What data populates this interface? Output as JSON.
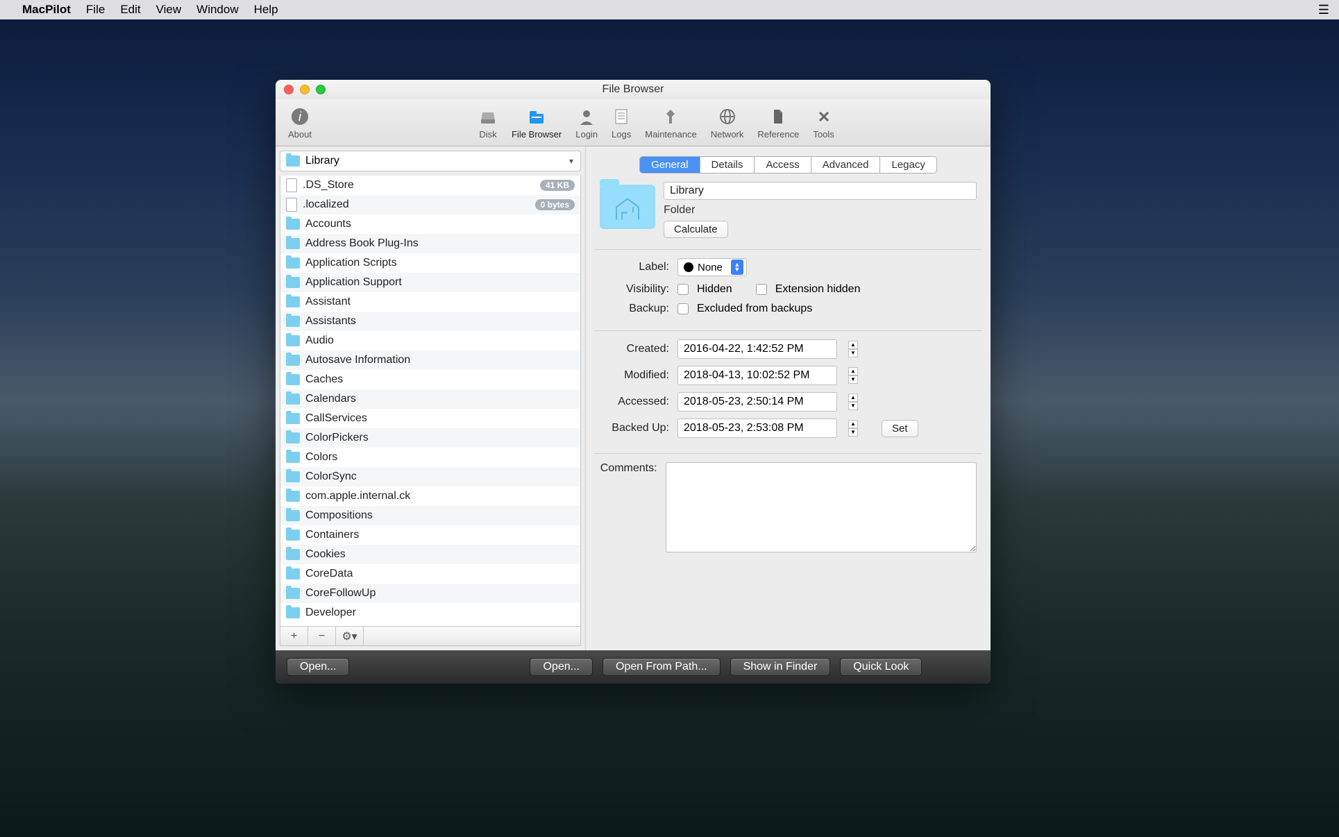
{
  "menubar": {
    "app": "MacPilot",
    "items": [
      "File",
      "Edit",
      "View",
      "Window",
      "Help"
    ]
  },
  "window": {
    "title": "File Browser"
  },
  "toolbar": {
    "items": [
      {
        "label": "About",
        "icon": "info"
      },
      {
        "label": "Disk",
        "icon": "disk"
      },
      {
        "label": "File Browser",
        "icon": "filebrowser",
        "active": true
      },
      {
        "label": "Login",
        "icon": "login"
      },
      {
        "label": "Logs",
        "icon": "logs"
      },
      {
        "label": "Maintenance",
        "icon": "maintenance"
      },
      {
        "label": "Network",
        "icon": "network"
      },
      {
        "label": "Reference",
        "icon": "reference"
      },
      {
        "label": "Tools",
        "icon": "tools"
      }
    ]
  },
  "path": "Library",
  "files": [
    {
      "name": ".DS_Store",
      "type": "file",
      "badge": "41 KB"
    },
    {
      "name": ".localized",
      "type": "file",
      "badge": "0 bytes"
    },
    {
      "name": "Accounts",
      "type": "folder"
    },
    {
      "name": "Address Book Plug-Ins",
      "type": "folder"
    },
    {
      "name": "Application Scripts",
      "type": "folder"
    },
    {
      "name": "Application Support",
      "type": "folder"
    },
    {
      "name": "Assistant",
      "type": "folder"
    },
    {
      "name": "Assistants",
      "type": "folder"
    },
    {
      "name": "Audio",
      "type": "folder"
    },
    {
      "name": "Autosave Information",
      "type": "folder"
    },
    {
      "name": "Caches",
      "type": "folder"
    },
    {
      "name": "Calendars",
      "type": "folder"
    },
    {
      "name": "CallServices",
      "type": "folder"
    },
    {
      "name": "ColorPickers",
      "type": "folder"
    },
    {
      "name": "Colors",
      "type": "folder"
    },
    {
      "name": "ColorSync",
      "type": "folder"
    },
    {
      "name": "com.apple.internal.ck",
      "type": "folder"
    },
    {
      "name": "Compositions",
      "type": "folder"
    },
    {
      "name": "Containers",
      "type": "folder"
    },
    {
      "name": "Cookies",
      "type": "folder"
    },
    {
      "name": "CoreData",
      "type": "folder"
    },
    {
      "name": "CoreFollowUp",
      "type": "folder"
    },
    {
      "name": "Developer",
      "type": "folder"
    }
  ],
  "tabs": [
    "General",
    "Details",
    "Access",
    "Advanced",
    "Legacy"
  ],
  "active_tab": "General",
  "info": {
    "name": "Library",
    "kind": "Folder",
    "calculate": "Calculate",
    "label_label": "Label:",
    "label_value": "None",
    "visibility_label": "Visibility:",
    "hidden": "Hidden",
    "ext_hidden": "Extension hidden",
    "backup_label": "Backup:",
    "excluded": "Excluded from backups",
    "created_label": "Created:",
    "created_value": "2016-04-22,   1:42:52 PM",
    "modified_label": "Modified:",
    "modified_value": "2018-04-13, 10:02:52 PM",
    "accessed_label": "Accessed:",
    "accessed_value": "2018-05-23,   2:50:14 PM",
    "backedup_label": "Backed Up:",
    "backedup_value": "2018-05-23,   2:53:08 PM",
    "set": "Set",
    "comments_label": "Comments:"
  },
  "bottom": {
    "open1": "Open...",
    "open2": "Open...",
    "open_path": "Open From Path...",
    "show_finder": "Show in Finder",
    "quick_look": "Quick Look"
  }
}
